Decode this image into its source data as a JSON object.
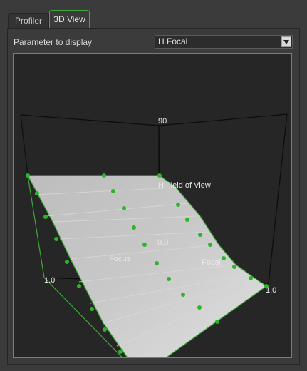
{
  "tabs": [
    {
      "label": "Profiler",
      "active": false
    },
    {
      "label": "3D View",
      "active": true
    }
  ],
  "parameter": {
    "label": "Parameter to display",
    "selected": "H Focal"
  },
  "view3d": {
    "tick_top": "90",
    "tick_center": "0.0",
    "tick_left": "1.0",
    "tick_right": "1.0",
    "label_vertical": "H Field of View",
    "label_focus": "Focus",
    "label_focal": "Focal"
  },
  "colors": {
    "accent": "#3ea83a",
    "surface": "#d2d2d2",
    "points": "#2bb52b",
    "background": "#262626"
  }
}
